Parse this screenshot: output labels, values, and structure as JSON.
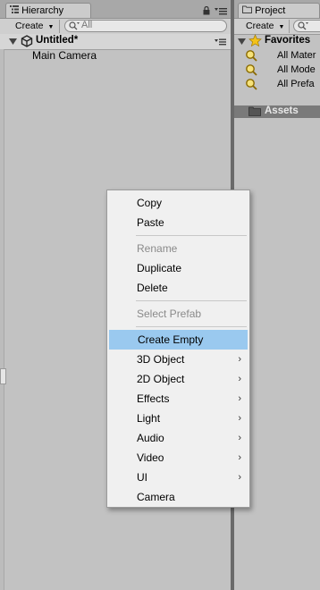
{
  "hierarchy": {
    "tab_label": "Hierarchy",
    "create_label": "Create",
    "search_placeholder": "All",
    "scene_name": "Untitled*",
    "objects": [
      "Main Camera"
    ]
  },
  "project": {
    "tab_label": "Project",
    "create_label": "Create",
    "favorites_label": "Favorites",
    "favorites": [
      "All Mater",
      "All Mode",
      "All Prefa"
    ],
    "assets_label": "Assets"
  },
  "context_menu": {
    "items": [
      {
        "label": "Copy",
        "enabled": true,
        "submenu": false
      },
      {
        "label": "Paste",
        "enabled": true,
        "submenu": false
      },
      {
        "label": "Rename",
        "enabled": false,
        "submenu": false
      },
      {
        "label": "Duplicate",
        "enabled": true,
        "submenu": false
      },
      {
        "label": "Delete",
        "enabled": true,
        "submenu": false
      },
      {
        "label": "Select Prefab",
        "enabled": false,
        "submenu": false
      },
      {
        "label": "Create Empty",
        "enabled": true,
        "submenu": false,
        "highlighted": true
      },
      {
        "label": "3D Object",
        "enabled": true,
        "submenu": true
      },
      {
        "label": "2D Object",
        "enabled": true,
        "submenu": true
      },
      {
        "label": "Effects",
        "enabled": true,
        "submenu": true
      },
      {
        "label": "Light",
        "enabled": true,
        "submenu": true
      },
      {
        "label": "Audio",
        "enabled": true,
        "submenu": true
      },
      {
        "label": "Video",
        "enabled": true,
        "submenu": true
      },
      {
        "label": "UI",
        "enabled": true,
        "submenu": true
      },
      {
        "label": "Camera",
        "enabled": true,
        "submenu": false
      }
    ]
  },
  "colors": {
    "highlight": "#9ac9ef",
    "panel_bg": "#c2c2c2",
    "menu_bg": "#f0f0f0"
  }
}
